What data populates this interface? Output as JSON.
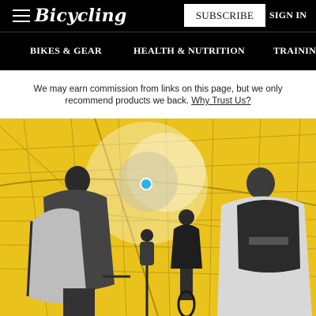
{
  "header": {
    "logo_text": "Bicycling",
    "subscribe_label": "SUBSCRIBE",
    "signin_label": "SIGN IN",
    "menu_icon": "hamburger-menu-icon"
  },
  "nav": {
    "items": [
      {
        "label": "BIKES & GEAR"
      },
      {
        "label": "HEALTH & NUTRITION"
      },
      {
        "label": "TRAINING"
      }
    ]
  },
  "disclaimer": {
    "text": "We may earn commission from links on this page, but we only recommend products we back.",
    "link_text": "Why Trust Us?"
  },
  "colors": {
    "header_bg": "#000000",
    "hero_yellow": "#e9c21c",
    "location_dot": "#2bb3e6"
  }
}
